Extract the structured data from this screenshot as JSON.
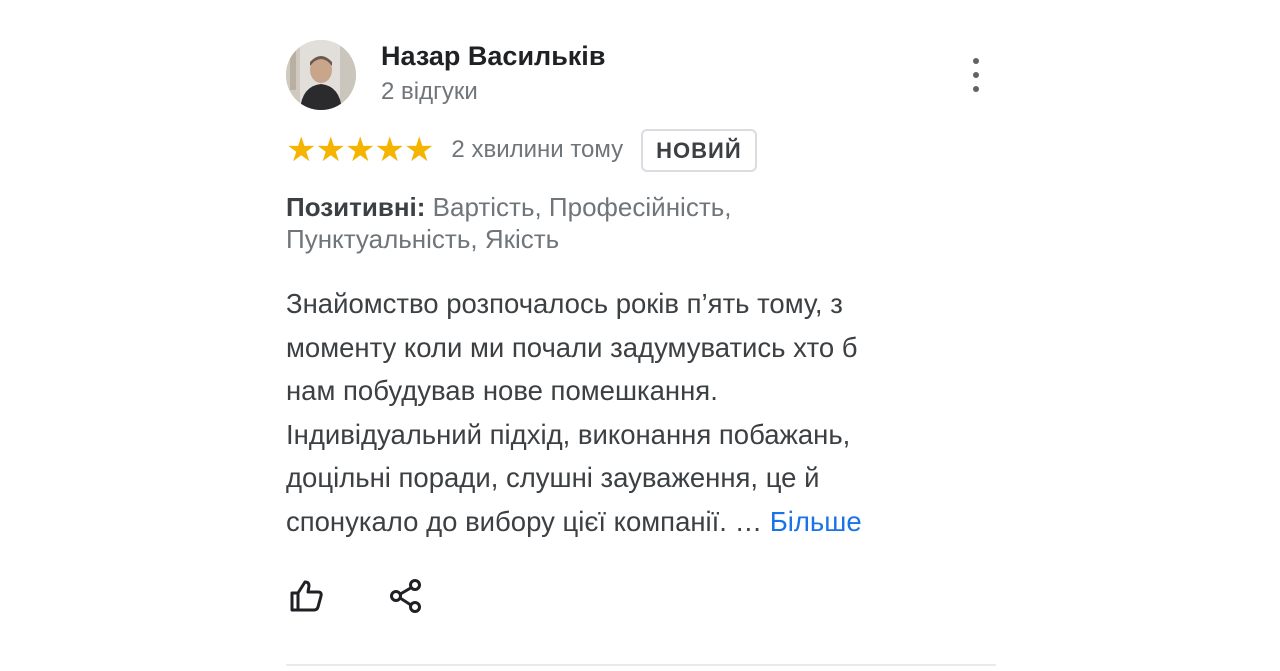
{
  "review": {
    "author": {
      "name": "Назар Васильків",
      "meta": "2 відгуки"
    },
    "rating": {
      "stars": 5,
      "time": "2 хвилини тому",
      "badge": "НОВИЙ"
    },
    "attributes": {
      "label": "Позитивні:",
      "values": "Вартість, Професійність,\n Пунктуальність, Якість"
    },
    "text": "Знайомство розпочалось років п’ять тому, з\nмоменту коли ми почали задумуватись хто б\nнам побудував нове помешкання.\nІндивідуальний підхід, виконання побажань,\nдоцільні поради, слушні зауваження,  це й\nспонукало до вибору цієї компанії. …",
    "more_link": "Більше",
    "icons": {
      "avatar": "avatar-photo",
      "menu": "more-vert-icon",
      "star": "star-icon",
      "like": "thumb-up-icon",
      "share": "share-icon"
    },
    "colors": {
      "star": "#f4b400",
      "link": "#1a73e8",
      "secondary_text": "#70757a"
    }
  }
}
